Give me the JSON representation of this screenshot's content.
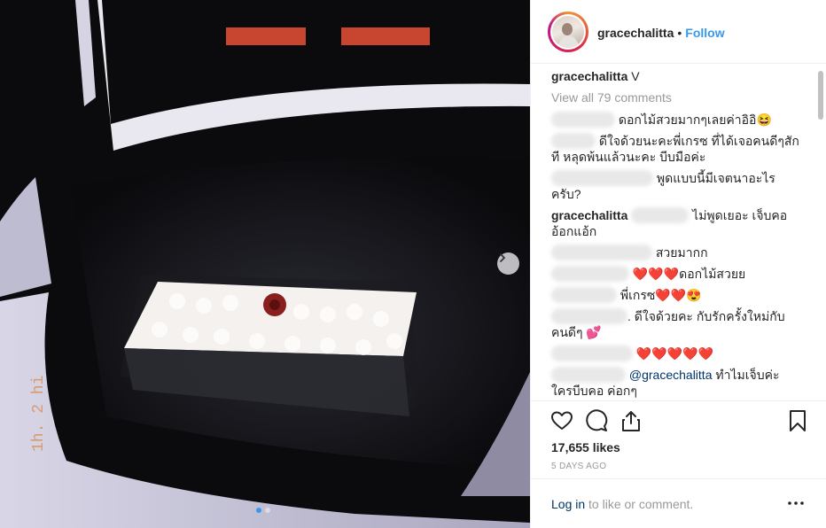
{
  "post": {
    "photo_overlay_text": "1h. 2 hi",
    "carousel": {
      "count": 2,
      "active_index": 0
    },
    "header": {
      "username": "gracechalitta",
      "separator": "•",
      "follow_label": "Follow"
    },
    "caption": {
      "username": "gracechalitta",
      "text": "V"
    },
    "view_all_comments": "View all 79 comments",
    "comments": [
      {
        "text": "ดอกไม้สวยมากๆเลยค่าอิอิ😆"
      },
      {
        "text1": "ดีใจด้วยนะคะพี่เกรซ ที่ได้เจอคนดีๆสัก",
        "text2": "ที หลุดพ้นแล้วนะคะ บีบมือค่ะ"
      },
      {
        "text1": "พูดแบบนี้มีเจตนาอะไร",
        "text2": "ครับ?"
      },
      {
        "username": "gracechalitta",
        "text1": "ไม่พูดเยอะ เจ็บคอ",
        "text2": "อ้อกแอ้ก"
      },
      {
        "text": "สวยมากก"
      },
      {
        "text": "❤️❤️❤️ดอกไม้สวยย"
      },
      {
        "text": "พี่เกรซ❤️❤️😍"
      },
      {
        "text1": ". ดีใจด้วยคะ กับรักครั้งใหม่กับ",
        "text2": "คนดีๆ 💕"
      },
      {
        "text": "❤️❤️❤️❤️❤️"
      },
      {
        "mention": "@gracechalitta",
        "text1": "ทำไมเจ็บค่ะ",
        "text2": "ใครบีบคอ ค่อกๆ"
      }
    ],
    "likes": "17,655 likes",
    "timestamp": "5 DAYS AGO",
    "login": {
      "link": "Log in",
      "text": "to like or comment."
    },
    "icons": {
      "like": "heart-icon",
      "comment": "comment-icon",
      "share": "share-icon",
      "save": "bookmark-icon",
      "more": "more-options-icon",
      "next": "chevron-right-icon"
    }
  }
}
